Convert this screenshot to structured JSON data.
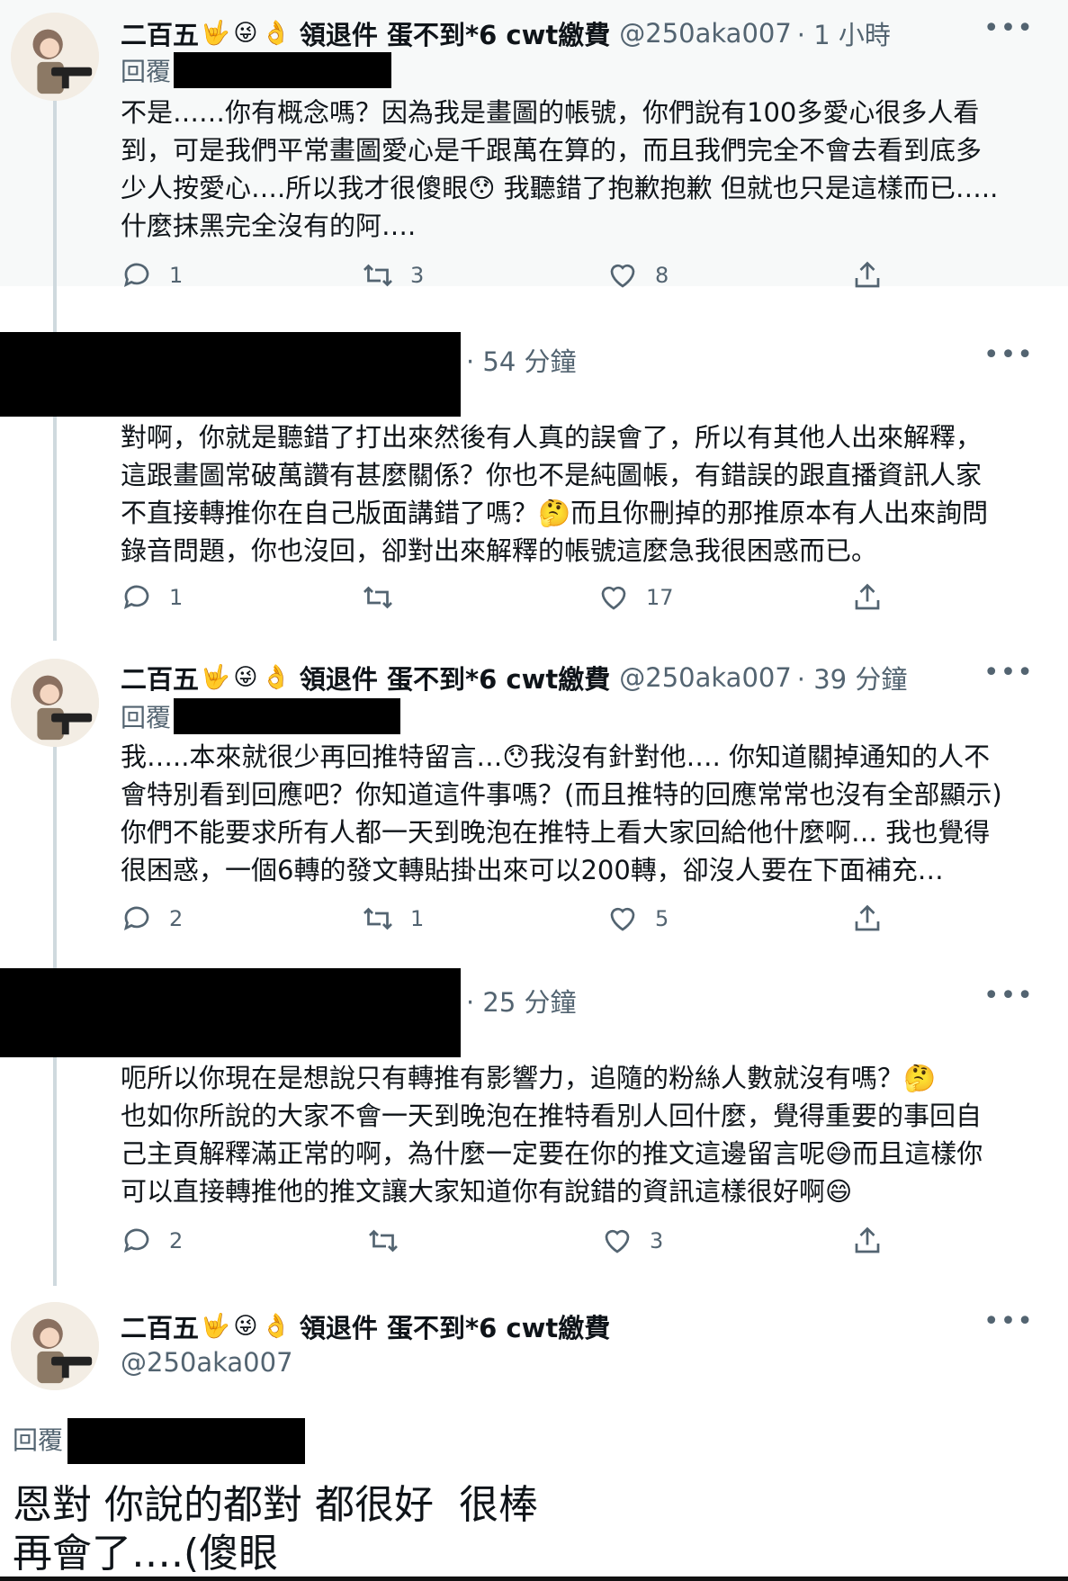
{
  "tweets": [
    {
      "name": "二百五",
      "emojis": [
        "🤟",
        "😜",
        "👌"
      ],
      "name_suffix": "領退件 蛋不到*6 cwt繳費",
      "handle": "@250aka007",
      "time": "· 1 小時",
      "reply_label": "回覆",
      "body": "不是……你有概念嗎？因為我是畫圖的帳號，你們說有100多愛心很多人看\n到，可是我們平常畫圖愛心是千跟萬在算的，而且我們完全不會去看到底多\n少人按愛心….所以我才很傻眼😯 我聽錯了抱歉抱歉 但就也只是這樣而已…..\n什麼抹黑完全沒有的阿….",
      "reply_count": "1",
      "retweet_count": "3",
      "like_count": "8"
    },
    {
      "time": "· 54 分鐘",
      "body": "對啊，你就是聽錯了打出來然後有人真的誤會了，所以有其他人出來解釋，\n這跟畫圖常破萬讚有甚麼關係？你也不是純圖帳，有錯誤的跟直播資訊人家\n不直接轉推你在自己版面講錯了嗎？🤔而且你刪掉的那推原本有人出來詢問\n錄音問題，你也沒回，卻對出來解釋的帳號這麼急我很困惑而已。",
      "reply_count": "1",
      "retweet_count": "",
      "like_count": "17"
    },
    {
      "name": "二百五",
      "emojis": [
        "🤟",
        "😜",
        "👌"
      ],
      "name_suffix": "領退件 蛋不到*6 cwt繳費",
      "handle": "@250aka007",
      "time": "· 39 分鐘",
      "reply_label": "回覆",
      "body": "我…..本來就很少再回推特留言…😯我沒有針對他…. 你知道關掉通知的人不\n會特別看到回應吧？你知道這件事嗎？(而且推特的回應常常也沒有全部顯示)\n你們不能要求所有人都一天到晚泡在推特上看大家回給他什麼啊… 我也覺得\n很困惑，一個6轉的發文轉貼掛出來可以200轉，卻沒人要在下面補充…",
      "reply_count": "2",
      "retweet_count": "1",
      "like_count": "5"
    },
    {
      "time": "· 25 分鐘",
      "body": "呃所以你現在是想說只有轉推有影響力，追隨的粉絲人數就沒有嗎？🤔\n也如你所說的大家不會一天到晚泡在推特看別人回什麼，覺得重要的事回自\n己主頁解釋滿正常的啊，為什麼一定要在你的推文這邊留言呢😅而且這樣你\n可以直接轉推他的推文讓大家知道你有說錯的資訊這樣很好啊😄",
      "reply_count": "2",
      "retweet_count": "",
      "like_count": "3"
    },
    {
      "name": "二百五",
      "emojis": [
        "🤟",
        "😜",
        "👌"
      ],
      "name_suffix": "領退件 蛋不到*6 cwt繳費",
      "handle": "@250aka007",
      "reply_label": "回覆",
      "body_line1": "恩對 你說的都對 都很好  很棒",
      "body_line2": "再會了….(傻眼"
    }
  ],
  "more_icon": "more-horizontal-icon",
  "icons": [
    "reply-icon",
    "retweet-icon",
    "like-icon",
    "share-icon"
  ],
  "colors": {
    "muted": "#536471",
    "text": "#0f1419",
    "thread": "#cfd9de"
  }
}
